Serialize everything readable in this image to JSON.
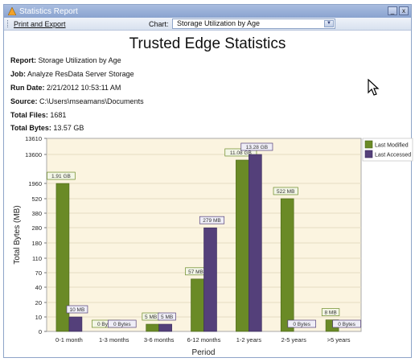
{
  "window": {
    "title": "Statistics Report",
    "minimize_label": "_",
    "close_label": "x"
  },
  "toolbar": {
    "print_export_label": "Print and Export",
    "chart_label": "Chart:",
    "chart_selected": "Storage Utilization by Age"
  },
  "report": {
    "title": "Trusted Edge Statistics",
    "fields": [
      {
        "label": "Report:",
        "value": "Storage Utilization by Age"
      },
      {
        "label": "Job:",
        "value": "Analyze ResData Server Storage"
      },
      {
        "label": "Run Date:",
        "value": "2/21/2012 10:53:11 AM"
      },
      {
        "label": "Source:",
        "value": "C:\\Users\\mseamans\\Documents"
      },
      {
        "label": "Total Files:",
        "value": "1681"
      },
      {
        "label": "Total Bytes:",
        "value": "13.57 GB"
      }
    ]
  },
  "colors": {
    "last_modified": "#6a8a26",
    "last_accessed": "#54407a",
    "plot_bg": "#fbf4e0"
  },
  "chart_data": {
    "type": "bar",
    "xlabel": "Period",
    "ylabel": "Total Bytes (MB)",
    "y_scale": "nonlinear (labeled ticks)",
    "y_ticks": [
      "0",
      "10",
      "20",
      "40",
      "70",
      "110",
      "180",
      "280",
      "380",
      "520",
      "1960",
      "13600",
      "13610"
    ],
    "legend_position": "top-right",
    "categories": [
      "0-1 month",
      "1-3 months",
      "3-6 months",
      "6-12 months",
      "1-2 years",
      "2-5 years",
      ">5 years"
    ],
    "series": [
      {
        "name": "Last Modified",
        "values_mb": [
          1955.84,
          0,
          5,
          57,
          11345.92,
          522,
          8
        ],
        "labels": [
          "1.91 GB",
          "0 Bytes",
          "5 MB",
          "57 MB",
          "11.08 GB",
          "522 MB",
          "8 MB"
        ]
      },
      {
        "name": "Last Accessed",
        "values_mb": [
          10,
          0,
          5,
          279,
          13598.72,
          0,
          0
        ],
        "labels": [
          "10 MB",
          "0 Bytes",
          "5 MB",
          "279 MB",
          "13.28 GB",
          "0 Bytes",
          "0 Bytes"
        ]
      }
    ]
  }
}
